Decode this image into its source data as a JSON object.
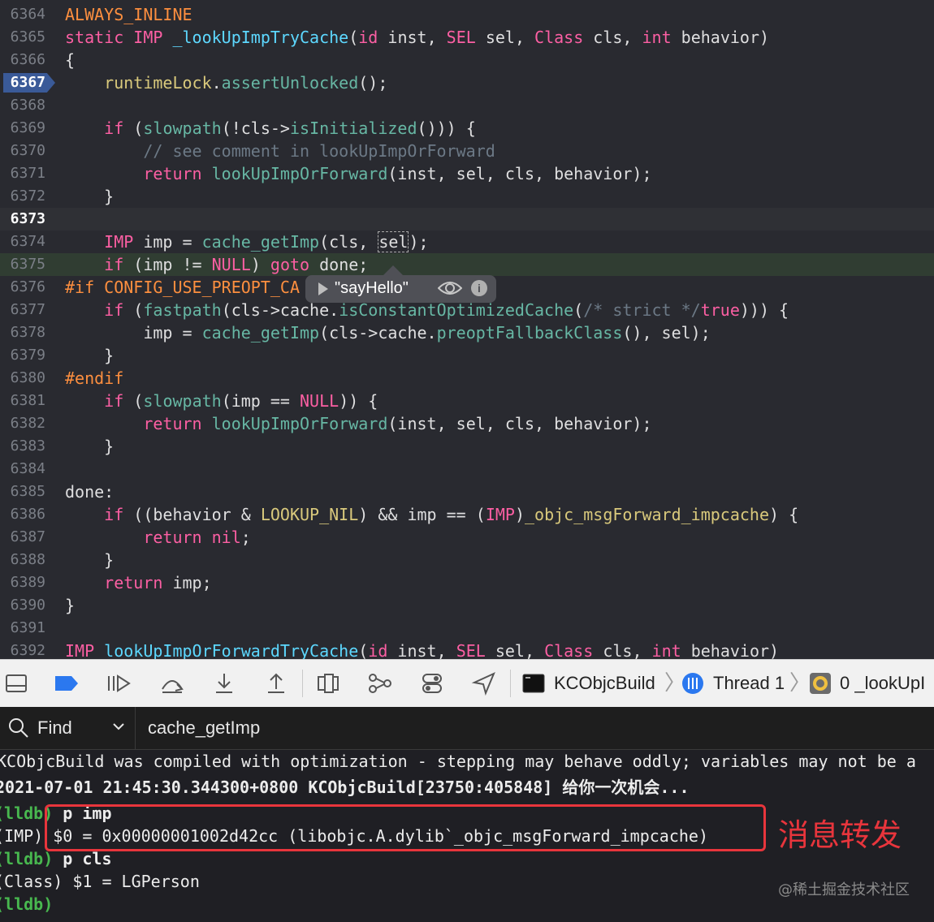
{
  "editor": {
    "current_line": "6367",
    "lines": [
      {
        "n": "6364",
        "t": "ALWAYS_INLINE"
      },
      {
        "n": "6365",
        "t": "static IMP _lookUpImpTryCache(id inst, SEL sel, Class cls, int behavior)"
      },
      {
        "n": "6366",
        "t": "{"
      },
      {
        "n": "6367",
        "t": "    runtimeLock.assertUnlocked();"
      },
      {
        "n": "6368",
        "t": ""
      },
      {
        "n": "6369",
        "t": "    if (slowpath(!cls->isInitialized())) {"
      },
      {
        "n": "6370",
        "t": "        // see comment in lookUpImpOrForward"
      },
      {
        "n": "6371",
        "t": "        return lookUpImpOrForward(inst, sel, cls, behavior);"
      },
      {
        "n": "6372",
        "t": "    }"
      },
      {
        "n": "6373",
        "t": ""
      },
      {
        "n": "6374",
        "t": "    IMP imp = cache_getImp(cls, sel);"
      },
      {
        "n": "6375",
        "t": "    if (imp != NULL) goto done;"
      },
      {
        "n": "6376",
        "t": "#if CONFIG_USE_PREOPT_CA"
      },
      {
        "n": "6377",
        "t": "    if (fastpath(cls->cache.isConstantOptimizedCache(/* strict */true))) {"
      },
      {
        "n": "6378",
        "t": "        imp = cache_getImp(cls->cache.preoptFallbackClass(), sel);"
      },
      {
        "n": "6379",
        "t": "    }"
      },
      {
        "n": "6380",
        "t": "#endif"
      },
      {
        "n": "6381",
        "t": "    if (slowpath(imp == NULL)) {"
      },
      {
        "n": "6382",
        "t": "        return lookUpImpOrForward(inst, sel, cls, behavior);"
      },
      {
        "n": "6383",
        "t": "    }"
      },
      {
        "n": "6384",
        "t": ""
      },
      {
        "n": "6385",
        "t": "done:"
      },
      {
        "n": "6386",
        "t": "    if ((behavior & LOOKUP_NIL) && imp == (IMP)_objc_msgForward_impcache) {"
      },
      {
        "n": "6387",
        "t": "        return nil;"
      },
      {
        "n": "6388",
        "t": "    }"
      },
      {
        "n": "6389",
        "t": "    return imp;"
      },
      {
        "n": "6390",
        "t": "}"
      },
      {
        "n": "6391",
        "t": ""
      },
      {
        "n": "6392",
        "t": "IMP lookUpImpOrForwardTryCache(id inst, SEL sel, Class cls, int behavior)"
      }
    ],
    "tooltip_value": "\"sayHello\""
  },
  "toolbar": {
    "target": "KCObjcBuild",
    "thread": "Thread 1",
    "frame": "0 _lookUpI"
  },
  "find": {
    "label": "Find",
    "query": "cache_getImp"
  },
  "console": {
    "lines": [
      "KCObjcBuild was compiled with optimization - stepping may behave oddly; variables may not be a",
      "2021-07-01 21:45:30.344300+0800 KCObjcBuild[23750:405848] 给你一次机会...",
      "(lldb) p imp",
      "(IMP) $0 = 0x00000001002d42cc (libobjc.A.dylib`_objc_msgForward_impcache)",
      "(lldb) p cls",
      "(Class) $1 = LGPerson",
      "(lldb)"
    ],
    "annotation": "消息转发",
    "watermark": "@稀土掘金技术社区"
  },
  "colors": {
    "editor_bg": "#292a30",
    "keyword": "#fc5fa3",
    "highlight_box": "#e8353c",
    "lldb_prompt": "#48b84f"
  }
}
